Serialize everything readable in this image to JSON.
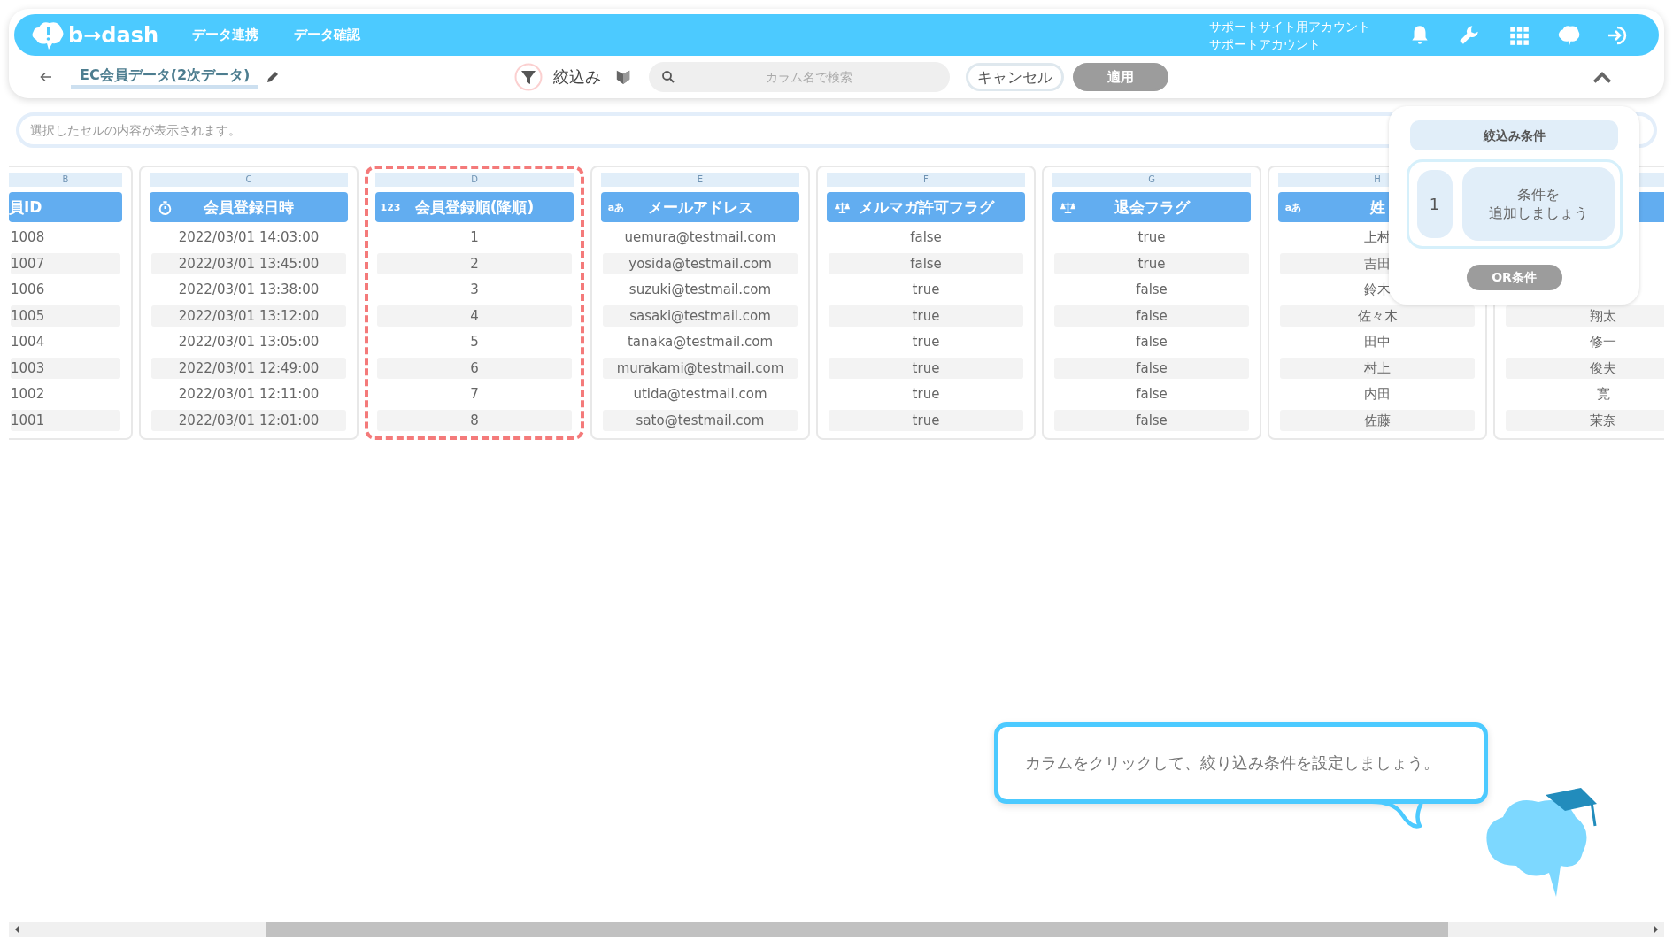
{
  "header": {
    "logo": "b→dash",
    "nav": [
      "データ連携",
      "データ確認"
    ],
    "account": [
      "サポートサイト用アカウント",
      "サポートアカウント"
    ]
  },
  "toolbar": {
    "title": "EC会員データ(2次データ)",
    "filter_label": "絞込み",
    "search": {
      "placeholder": "カラム名で検索"
    },
    "buttons": [
      {
        "label": "キャンセル",
        "disabled": false
      },
      {
        "label": "適用",
        "disabled": true
      }
    ]
  },
  "cell_field": {
    "placeholder": "選択したセルの内容が表示されます。"
  },
  "columns": [
    {
      "letter": "B",
      "title": "員ID",
      "kind": "id",
      "highlighted": false,
      "cells": [
        "1008",
        "1007",
        "1006",
        "1005",
        "1004",
        "1003",
        "1002",
        "1001"
      ]
    },
    {
      "letter": "C",
      "title": "会員登録日時",
      "kind": "datetime",
      "highlighted": false,
      "cells": [
        "2022/03/01 14:03:00",
        "2022/03/01 13:45:00",
        "2022/03/01 13:38:00",
        "2022/03/01 13:12:00",
        "2022/03/01 13:05:00",
        "2022/03/01 12:49:00",
        "2022/03/01 12:11:00",
        "2022/03/01 12:01:00"
      ]
    },
    {
      "letter": "D",
      "title": "会員登録順(降順)",
      "kind": "number",
      "type_label": "123",
      "highlighted": true,
      "cells": [
        "1",
        "2",
        "3",
        "4",
        "5",
        "6",
        "7",
        "8"
      ]
    },
    {
      "letter": "E",
      "title": "メールアドレス",
      "kind": "text",
      "type_label": "aあ",
      "highlighted": false,
      "cells": [
        "uemura@testmail.com",
        "yosida@testmail.com",
        "suzuki@testmail.com",
        "sasaki@testmail.com",
        "tanaka@testmail.com",
        "murakami@testmail.com",
        "utida@testmail.com",
        "sato@testmail.com"
      ]
    },
    {
      "letter": "F",
      "title": "メルマガ許可フラグ",
      "kind": "boolean",
      "highlighted": false,
      "cells": [
        "false",
        "false",
        "true",
        "true",
        "true",
        "true",
        "true",
        "true"
      ]
    },
    {
      "letter": "G",
      "title": "退会フラグ",
      "kind": "boolean",
      "highlighted": false,
      "cells": [
        "true",
        "true",
        "false",
        "false",
        "false",
        "false",
        "false",
        "false"
      ]
    },
    {
      "letter": "H",
      "title": "姓",
      "kind": "text",
      "type_label": "aあ",
      "highlighted": false,
      "cells": [
        "上村",
        "吉田",
        "鈴木",
        "佐々木",
        "田中",
        "村上",
        "内田",
        "佐藤"
      ]
    },
    {
      "highlighted": false,
      "cells": [
        "翔太",
        "修一",
        "俊夫",
        "寛",
        "茉奈"
      ]
    }
  ],
  "filter_panel": {
    "title": "絞込み条件",
    "groups": [
      {
        "number": "1",
        "hint": [
          "条件を",
          "追加しましょう"
        ]
      }
    ],
    "or_button": {
      "label": "OR条件",
      "disabled": true
    }
  },
  "tooltip": {
    "text": "カラムをクリックして、絞り込み条件を設定しましょう。"
  }
}
